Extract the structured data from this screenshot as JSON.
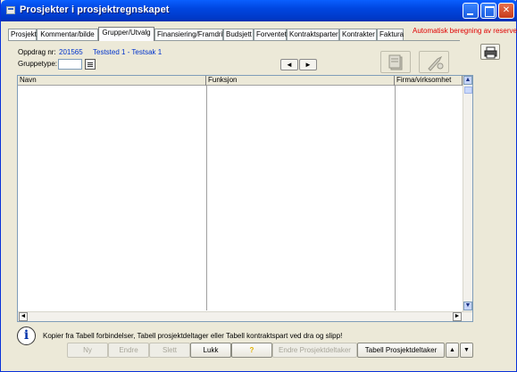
{
  "window": {
    "title": "Prosjekter i prosjektregnskapet",
    "auto_note": "Automatisk beregning av reserver!"
  },
  "tabs": [
    {
      "label": "Prosjekt",
      "active": false
    },
    {
      "label": "Kommentar/bilde",
      "active": false
    },
    {
      "label": "Grupper/Utvalg",
      "active": true
    },
    {
      "label": "Finansiering/Framdrift",
      "active": false
    },
    {
      "label": "Budsjett",
      "active": false
    },
    {
      "label": "Forventet",
      "active": false
    },
    {
      "label": "Kontraktsparter",
      "active": false
    },
    {
      "label": "Kontrakter",
      "active": false
    },
    {
      "label": "Faktura",
      "active": false
    }
  ],
  "info": {
    "oppdrag_label": "Oppdrag nr:",
    "oppdrag_value": "201565",
    "oppdrag_name": "Teststed 1 - Testsak 1",
    "gruppetype_label": "Gruppetype:",
    "gruppetype_value": ""
  },
  "nav": {
    "prev": "◄",
    "next": "►"
  },
  "grid": {
    "columns": [
      "Navn",
      "Funksjon",
      "Firma/virksomhet"
    ],
    "rows": []
  },
  "hint": "Kopier fra Tabell forbindelser, Tabell prosjektdeltager eller Tabell kontraktspart ved dra og slipp!",
  "buttons": {
    "ny": "Ny",
    "endre": "Endre",
    "slett": "Slett",
    "lukk": "Lukk",
    "help": "?",
    "endre_prosjektdeltaker": "Endre Prosjektdeltaker",
    "tabell_prosjektdeltaker": "Tabell Prosjektdeltaker",
    "up": "▲",
    "down": "▼"
  },
  "colors": {
    "title_bar": "#0046e0",
    "auto_note": "#e00000",
    "oppdrag_value": "#0033cc"
  }
}
